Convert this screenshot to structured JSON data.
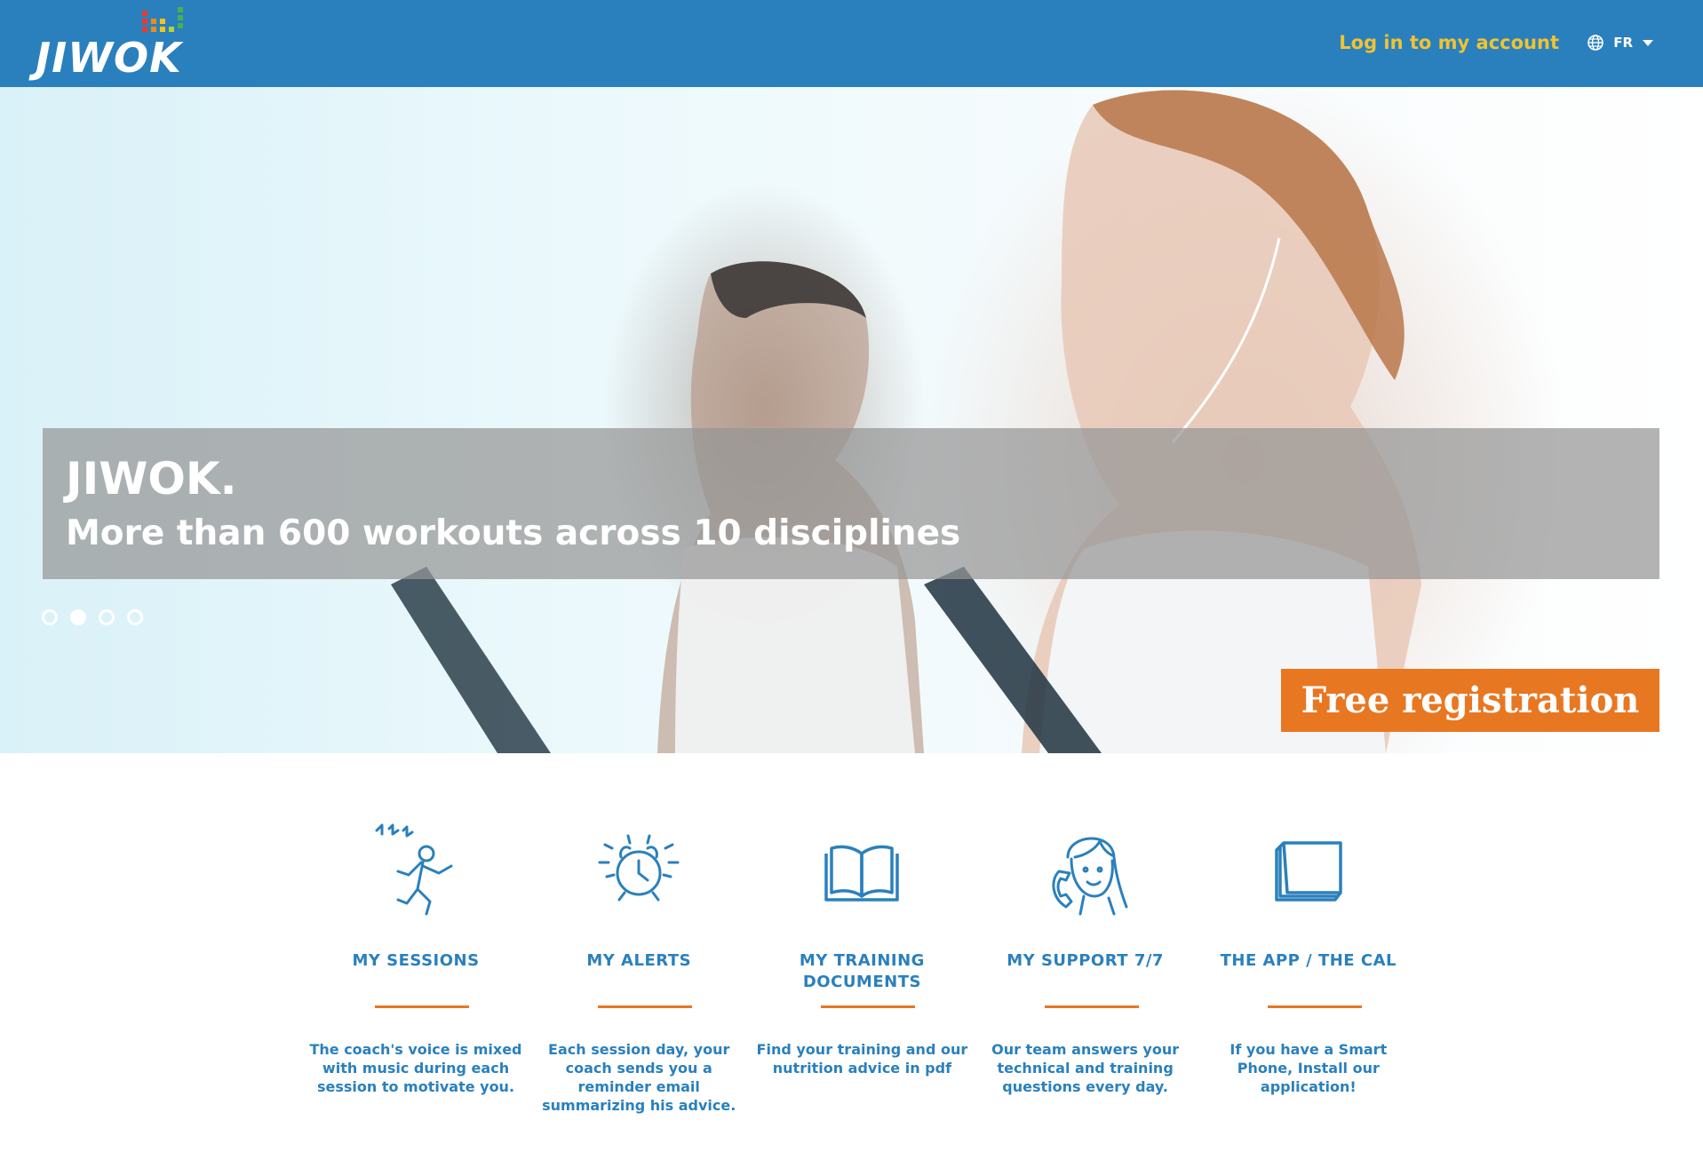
{
  "header": {
    "logo_text": "JIWOK",
    "login_label": "Log in to my account",
    "language": "FR",
    "icons": {
      "globe": "globe-icon",
      "dropdown": "caret-down-icon"
    }
  },
  "hero": {
    "title": "JIWOK.",
    "subtitle": "More than 600 workouts across 10 disciplines",
    "slides_total": 4,
    "active_slide": 2,
    "register_label": "Free registration"
  },
  "features": [
    {
      "icon": "runner-music-icon",
      "title": "MY SESSIONS",
      "description": "The coach's voice is mixed with music during each session to motivate you."
    },
    {
      "icon": "alarm-clock-icon",
      "title": "MY ALERTS",
      "description": "Each session day, your coach sends you a reminder email summarizing his advice."
    },
    {
      "icon": "open-book-icon",
      "title": "MY TRAINING DOCUMENTS",
      "description": "Find your training and our nutrition advice in pdf"
    },
    {
      "icon": "support-agent-icon",
      "title": "MY SUPPORT 7/7",
      "description": "Our team answers your technical and training questions every day."
    },
    {
      "icon": "calendar-pad-icon",
      "title": "THE APP / THE CAL",
      "description": "If you have a Smart Phone, Install our application!"
    }
  ],
  "colors": {
    "header_bg": "#2a80bd",
    "login_link": "#f1c232",
    "accent_orange": "#e87722",
    "feature_text": "#2a80bd"
  }
}
